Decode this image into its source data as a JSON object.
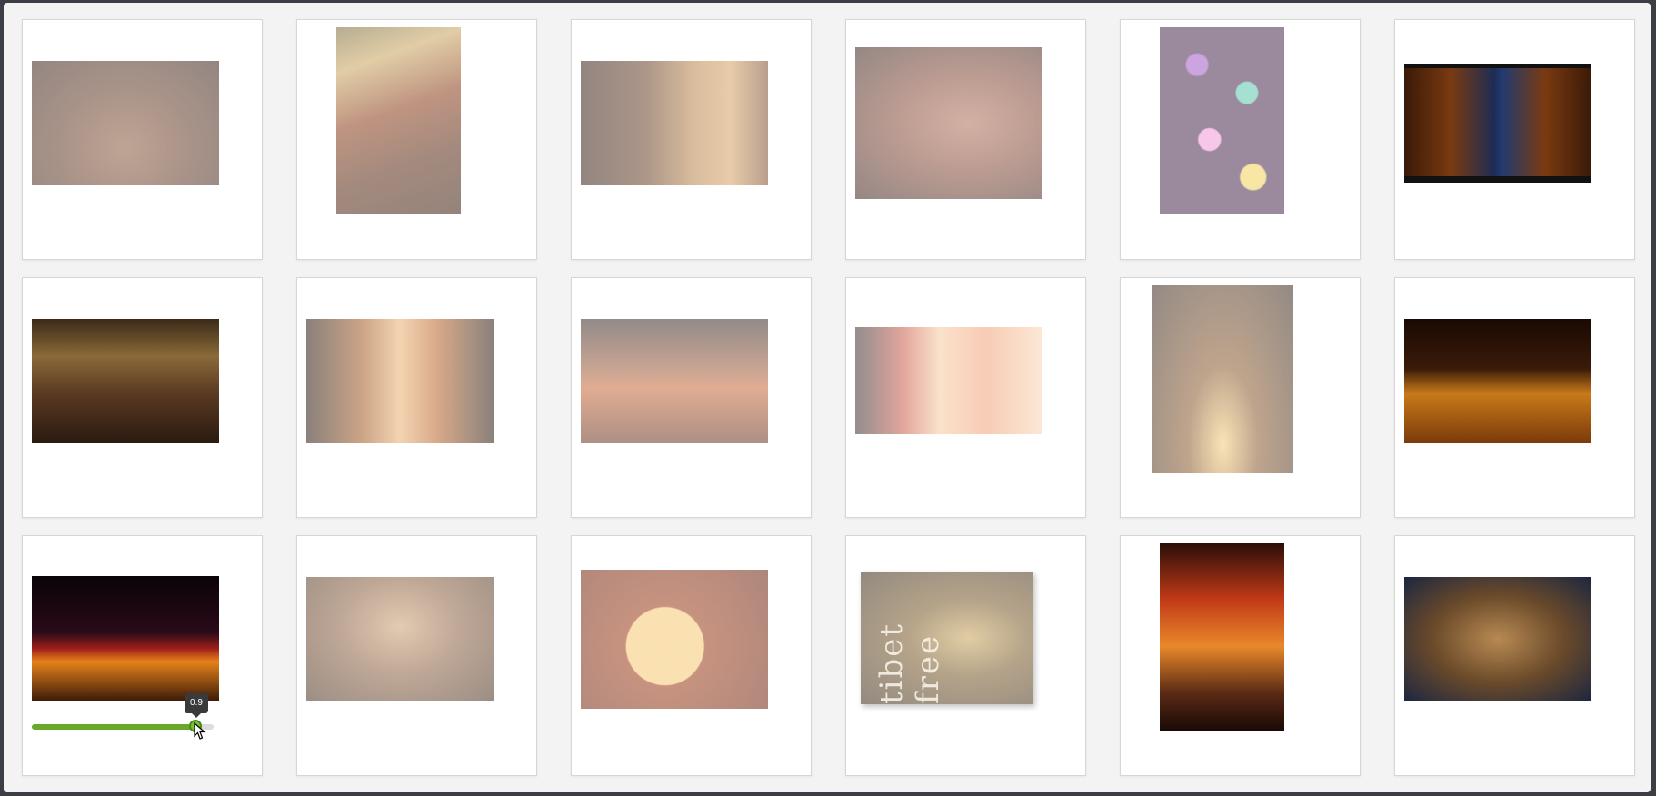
{
  "gallery": {
    "cards": [
      {
        "id": "pub",
        "opacity": "faded"
      },
      {
        "id": "spices",
        "opacity": "faded"
      },
      {
        "id": "woman",
        "opacity": "faded"
      },
      {
        "id": "face",
        "opacity": "faded"
      },
      {
        "id": "bokeh",
        "opacity": "faded"
      },
      {
        "id": "alley",
        "opacity": "vivid"
      },
      {
        "id": "library",
        "opacity": "vivid"
      },
      {
        "id": "forest",
        "opacity": "faded"
      },
      {
        "id": "bike",
        "opacity": "faded"
      },
      {
        "id": "sun",
        "opacity": "faded"
      },
      {
        "id": "ivy",
        "opacity": "faded"
      },
      {
        "id": "highway",
        "opacity": "vivid"
      },
      {
        "id": "bridge",
        "opacity": "vivid"
      },
      {
        "id": "auditorium",
        "opacity": "faded"
      },
      {
        "id": "cube",
        "opacity": "faded"
      },
      {
        "id": "buddha",
        "opacity": "faded"
      },
      {
        "id": "rain",
        "opacity": "vivid"
      },
      {
        "id": "ship",
        "opacity": "vivid"
      }
    ],
    "buddha_watermark": "tibet free"
  },
  "opacity_slider": {
    "value": 0.9,
    "tooltip": "0.9",
    "fill_color": "#6aa82a",
    "handle_color": "#79c23c"
  }
}
